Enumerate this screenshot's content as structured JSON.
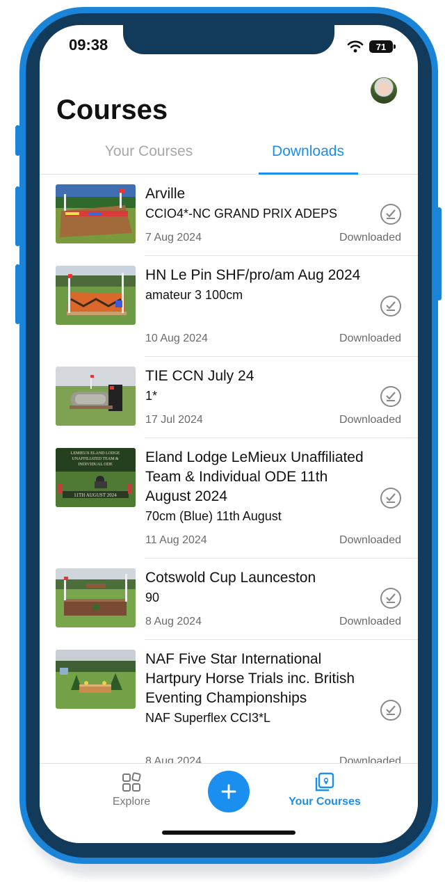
{
  "status_bar": {
    "time": "09:38",
    "battery": "71"
  },
  "header": {
    "title": "Courses"
  },
  "tabs": [
    {
      "label": "Your Courses",
      "active": false
    },
    {
      "label": "Downloads",
      "active": true
    }
  ],
  "courses": [
    {
      "title": "Arville",
      "subtitle": "CCIO4*-NC GRAND PRIX ADEPS",
      "date": "7 Aug 2024",
      "status": "Downloaded"
    },
    {
      "title": "HN Le Pin SHF/pro/am Aug 2024",
      "subtitle": "amateur 3 100cm",
      "date": "10 Aug 2024",
      "status": "Downloaded"
    },
    {
      "title": "TIE CCN July 24",
      "subtitle": "1*",
      "date": "17 Jul 2024",
      "status": "Downloaded"
    },
    {
      "title": "Eland Lodge LeMieux Unaffiliated Team & Individual ODE 11th August 2024",
      "subtitle": "70cm (Blue) 11th August",
      "date": "11 Aug 2024",
      "status": "Downloaded"
    },
    {
      "title": "Cotswold Cup Launceston",
      "subtitle": "90",
      "date": "8 Aug 2024",
      "status": "Downloaded"
    },
    {
      "title": "NAF Five Star International Hartpury Horse Trials inc. British Eventing Championships",
      "subtitle": "NAF Superflex CCI3*L",
      "date": "8 Aug 2024",
      "status": "Downloaded"
    }
  ],
  "thumbnail_text": {
    "eland_banner_1": "LEMIEUX ELAND LODGE",
    "eland_banner_2": "UNAFFILIATED TEAM &",
    "eland_banner_3": "INDIVIDUAL ODE",
    "eland_banner_4": "11TH AUGUST 2024"
  },
  "tab_bar": {
    "explore_label": "Explore",
    "courses_label": "Your Courses",
    "add_icon": "plus-icon"
  },
  "colors": {
    "accent": "#1a8ff0",
    "frame": "#1a85d8",
    "frame_inner": "#123a5a"
  }
}
